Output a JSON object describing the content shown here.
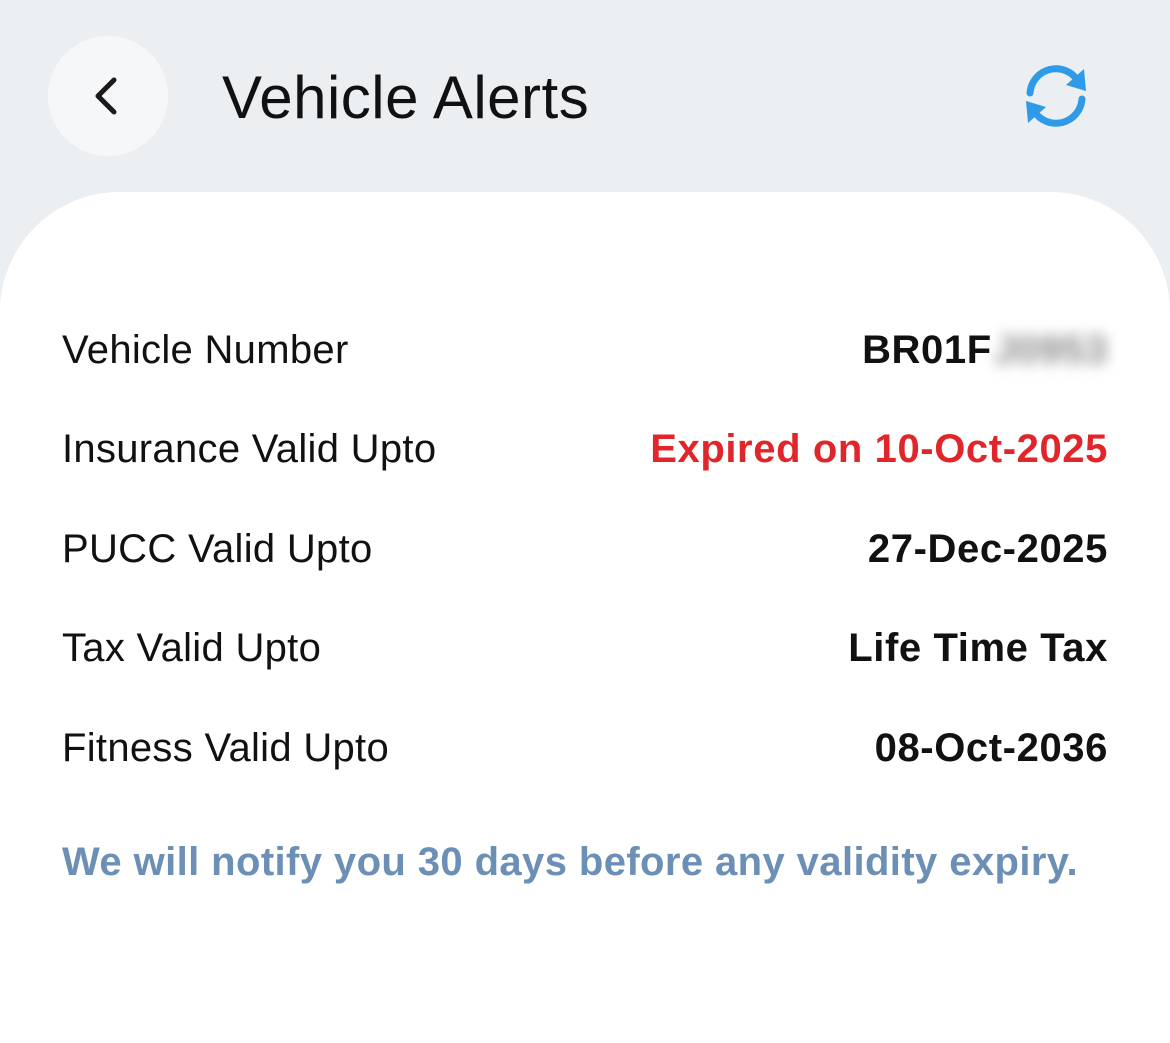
{
  "header": {
    "title": "Vehicle Alerts",
    "back_icon": "chevron-left-icon",
    "refresh_icon": "refresh-icon",
    "refresh_color": "#2f9ae8"
  },
  "details": {
    "vehicle_number": {
      "label": "Vehicle Number",
      "value_prefix": "BR01F",
      "value_redacted": "J0953"
    },
    "insurance": {
      "label": "Insurance Valid Upto",
      "value": "Expired on 10-Oct-2025",
      "status_color": "#e0262a"
    },
    "pucc": {
      "label": "PUCC Valid Upto",
      "value": "27-Dec-2025"
    },
    "tax": {
      "label": "Tax Valid Upto",
      "value": "Life Time Tax"
    },
    "fitness": {
      "label": "Fitness Valid Upto",
      "value": "08-Oct-2036"
    }
  },
  "note": "We will notify you 30 days before any validity expiry."
}
